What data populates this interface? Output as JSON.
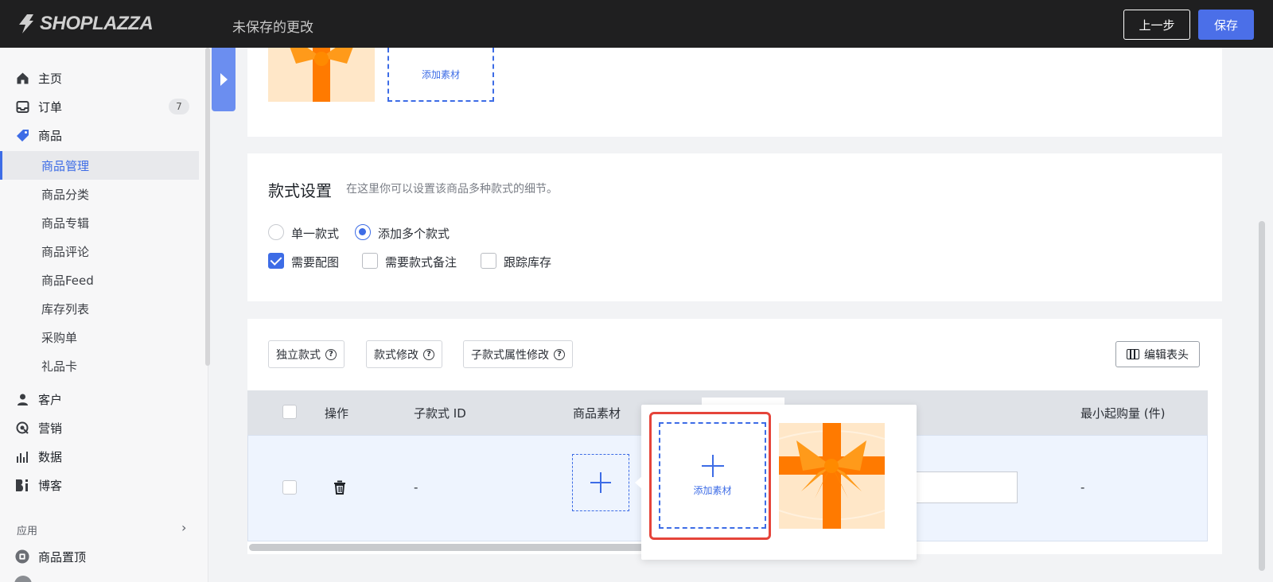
{
  "header": {
    "logo_text": "SHOPLAZZA",
    "unsaved_text": "未保存的更改",
    "prev_button": "上一步",
    "save_button": "保存"
  },
  "sidebar": {
    "items": [
      {
        "label": "主页",
        "icon": "home-icon"
      },
      {
        "label": "订单",
        "icon": "inbox-icon",
        "badge": "7"
      },
      {
        "label": "商品",
        "icon": "tag-icon"
      }
    ],
    "product_sub": [
      {
        "label": "商品管理",
        "active": true
      },
      {
        "label": "商品分类"
      },
      {
        "label": "商品专辑"
      },
      {
        "label": "商品评论"
      },
      {
        "label": "商品Feed"
      },
      {
        "label": "库存列表"
      },
      {
        "label": "采购单"
      },
      {
        "label": "礼品卡"
      }
    ],
    "more_items": [
      {
        "label": "客户",
        "icon": "user-icon"
      },
      {
        "label": "营销",
        "icon": "target-icon"
      },
      {
        "label": "数据",
        "icon": "bar-chart-icon"
      },
      {
        "label": "博客",
        "icon": "blog-icon"
      }
    ],
    "apps_label": "应用",
    "apps_items": [
      {
        "label": "商品置顶",
        "icon": "pin-app-icon"
      }
    ]
  },
  "top_card": {
    "add_material_label": "添加素材"
  },
  "variant_settings": {
    "title": "款式设置",
    "description": "在这里你可以设置该商品多种款式的细节。",
    "radio_single": "单一款式",
    "radio_multi": "添加多个款式",
    "check_image": "需要配图",
    "check_note": "需要款式备注",
    "check_inventory": "跟踪库存"
  },
  "toolbar": {
    "chip_independent": "独立款式",
    "chip_modify": "款式修改",
    "chip_sub_modify": "子款式属性修改",
    "edit_columns": "编辑表头"
  },
  "table": {
    "headers": {
      "action": "操作",
      "sub_id": "子款式 ID",
      "material": "商品素材",
      "min_qty": "最小起购量 (件)"
    },
    "row": {
      "sub_id": "-",
      "min_qty": "-"
    }
  },
  "popover": {
    "add_material_label": "添加素材"
  },
  "colors": {
    "accent": "#3d6ce6",
    "highlight": "#e5443a",
    "gift_orange": "#ff7a00"
  }
}
